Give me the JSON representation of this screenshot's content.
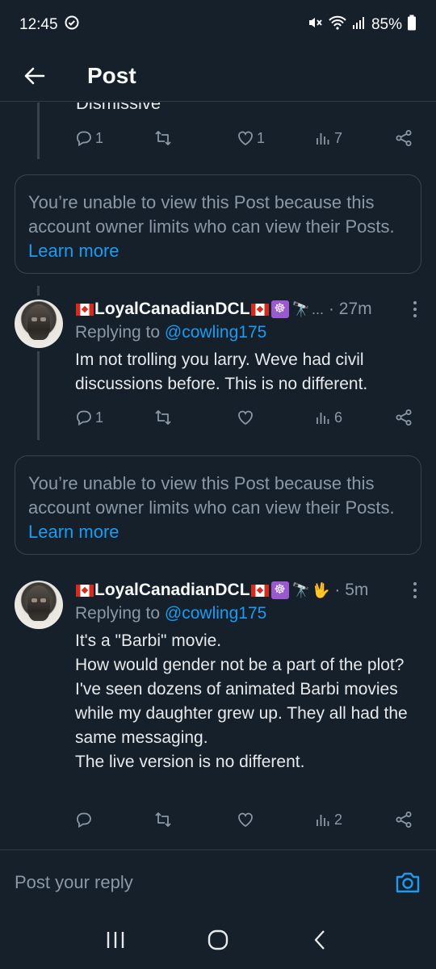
{
  "status": {
    "time": "12:45",
    "battery": "85%"
  },
  "header": {
    "title": "Post"
  },
  "previous": {
    "partial_text": "Dismissive",
    "reply_count": "1",
    "like_count": "1",
    "view_count": "7"
  },
  "notice1": {
    "text": "You’re unable to view this Post because this account owner limits who can view their Posts.",
    "link": "Learn more"
  },
  "post1": {
    "name": "LoyalCanadianDCL",
    "time": "· 27m",
    "replying_prefix": "Replying to ",
    "replying_handle": "@cowling175",
    "text": "Im not trolling you larry.  Weve had civil discussions before.  This is no different.",
    "reply_count": "1",
    "like_count": "",
    "view_count": "6"
  },
  "notice2": {
    "text": "You’re unable to view this Post because this account owner limits who can view their Posts.",
    "link": "Learn more"
  },
  "post2": {
    "name": "LoyalCanadianDCL",
    "time": "· 5m",
    "replying_prefix": "Replying to ",
    "replying_handle": "@cowling175",
    "lines": [
      "It's a \"Barbi\" movie.",
      "How would gender not be a part of the plot?",
      "I've seen dozens of animated Barbi movies while my daughter grew up.  They all had the same messaging.",
      "The live version is no different."
    ],
    "reply_count": "",
    "like_count": "",
    "view_count": "2"
  },
  "composer": {
    "placeholder": "Post your reply"
  },
  "icons": [
    "check-circle-icon",
    "mute-icon",
    "wifi-icon",
    "signal-icon",
    "battery-icon",
    "back-arrow-icon",
    "reply-icon",
    "retweet-icon",
    "like-icon",
    "views-icon",
    "share-icon",
    "more-icon",
    "camera-icon",
    "recents-icon",
    "home-icon",
    "nav-back-icon"
  ],
  "colors": {
    "background": "#15202b",
    "accent": "#1d9bf0",
    "muted": "#8b98a5"
  }
}
